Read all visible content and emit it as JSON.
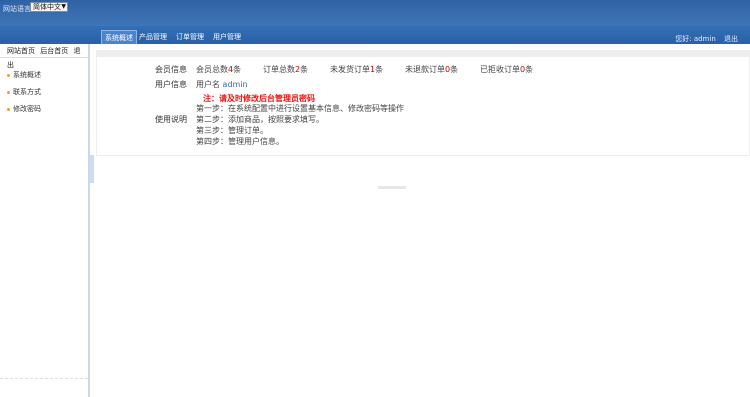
{
  "header": {
    "lang_label": "网站语言",
    "lang_value": "简体中文"
  },
  "nav": {
    "tabs": [
      {
        "label": "系统概述"
      },
      {
        "label": "产品管理"
      },
      {
        "label": "订单管理"
      },
      {
        "label": "用户管理"
      }
    ],
    "greeting": "您好:",
    "username": "admin",
    "logout": "退出"
  },
  "sidebar": {
    "links": [
      {
        "label": "网站首页"
      },
      {
        "label": "后台首页"
      },
      {
        "label": "退出"
      }
    ],
    "items": [
      {
        "label": "系统概述",
        "dot_color": "#f0a020"
      },
      {
        "label": "联系方式",
        "dot_color": "#f0a020"
      },
      {
        "label": "修改密码",
        "dot_color": "#f0a020"
      }
    ]
  },
  "main": {
    "member_label": "会员信息",
    "stats": [
      {
        "label": "会员总数",
        "count": "4",
        "unit": "条"
      },
      {
        "label": "订单总数",
        "count": "2",
        "unit": "条"
      },
      {
        "label": "未发货订单",
        "count": "1",
        "unit": "条"
      },
      {
        "label": "未退款订单",
        "count": "0",
        "unit": "条"
      },
      {
        "label": "已拒收订单",
        "count": "0",
        "unit": "条"
      }
    ],
    "user_label": "用户信息",
    "username_label": "用户名",
    "username_value": "admin",
    "instructions_label": "使用说明",
    "notice": "注：请及时修改后台管理员密码",
    "steps": [
      "第一步：在系统配置中进行设置基本信息、修改密码等操作",
      "第二步：添加商品，按照要求填写。",
      "第三步：管理订单。",
      "第四步：管理用户信息。"
    ]
  }
}
